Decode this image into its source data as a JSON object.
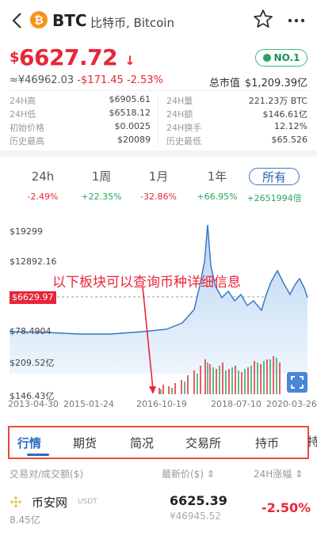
{
  "header": {
    "coin_symbol_letter": "₿",
    "title": "BTC",
    "subtitle": "比特币, Bitcoin",
    "back_icon": "chevron-left-icon",
    "star_icon": "star-icon",
    "more_icon": "more-horizontal-icon"
  },
  "price": {
    "currency": "$",
    "value": "6627.72",
    "arrow": "↓",
    "cny": "≈¥46962.03",
    "change": "-$171.45",
    "change_pct": "-2.53%",
    "rank": "NO.1",
    "market_cap_label": "总市值",
    "market_cap": "$1,209.39亿"
  },
  "stats": [
    [
      {
        "label": "24H高",
        "value": "$6905.61"
      },
      {
        "label": "24H量",
        "value": "221.23万 BTC"
      }
    ],
    [
      {
        "label": "24H低",
        "value": "$6518.12"
      },
      {
        "label": "24H额",
        "value": "$146.61亿"
      }
    ],
    [
      {
        "label": "初始价格",
        "value": "$0.0025"
      },
      {
        "label": "24H换手",
        "value": "12.12%"
      }
    ],
    [
      {
        "label": "历史最高",
        "value": "$20089"
      },
      {
        "label": "历史最低",
        "value": "$65.526"
      }
    ]
  ],
  "periods": [
    {
      "label": "24h",
      "change": "-2.49%",
      "dir": "neg"
    },
    {
      "label": "1周",
      "change": "+22.35%",
      "dir": "pos"
    },
    {
      "label": "1月",
      "change": "-32.86%",
      "dir": "neg"
    },
    {
      "label": "1年",
      "change": "+66.95%",
      "dir": "pos"
    },
    {
      "label": "所有",
      "change": "+2651994倍",
      "dir": "pos"
    }
  ],
  "chart": {
    "y_high": "$19299",
    "y_mid": "$12892.16",
    "current_tag": "$6629.97",
    "y_low": "$78.4904",
    "vol_high": "$209.52亿",
    "vol_low": "$146.43亿",
    "x_labels": [
      "2013-04-30",
      "2015-01-24",
      "2016-10-19",
      "2018-07-10",
      "2020-03-26"
    ],
    "annotation": "以下板块可以查询币种详细信息",
    "line_color": "#2f74c9",
    "fill_color": "#d6e6f7",
    "fullscreen_icon": "expand-icon"
  },
  "tabs": [
    "行情",
    "期货",
    "简况",
    "交易所",
    "持币"
  ],
  "tab_cut": "持",
  "table": {
    "col1": "交易对/成交额($)",
    "col2": "最新价($)",
    "col3": "24H涨幅",
    "sort_icon": "sort-icon"
  },
  "rows": [
    {
      "name": "币安网",
      "pair": "USDT",
      "volume": "8.45亿",
      "price": "6625.39",
      "cny": "¥46945.52",
      "change": "-2.50%"
    }
  ]
}
